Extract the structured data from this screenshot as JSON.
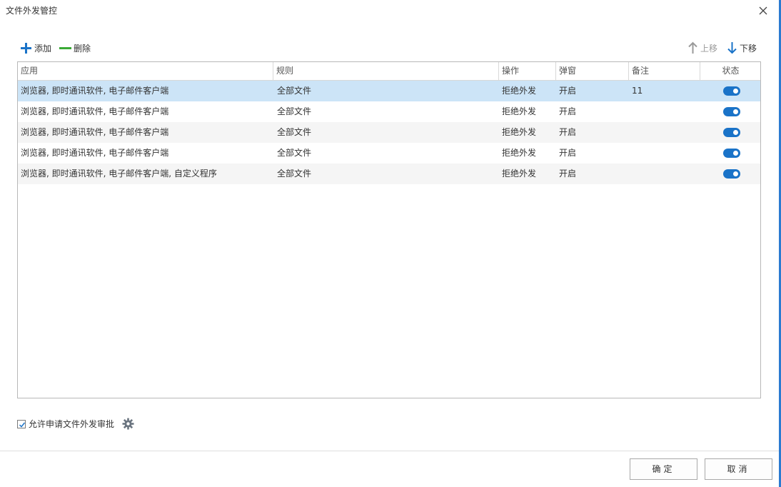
{
  "window": {
    "title": "文件外发管控"
  },
  "toolbar": {
    "add_label": "添加",
    "delete_label": "删除",
    "up_label": "上移",
    "down_label": "下移"
  },
  "table": {
    "columns": [
      "应用",
      "规则",
      "操作",
      "弹窗",
      "备注",
      "状态"
    ],
    "rows": [
      {
        "app": "浏览器, 即时通讯软件, 电子邮件客户端",
        "rule": "全部文件",
        "op": "拒绝外发",
        "popup": "开启",
        "note": "11",
        "status": true,
        "selected": true
      },
      {
        "app": "浏览器, 即时通讯软件, 电子邮件客户端",
        "rule": "全部文件",
        "op": "拒绝外发",
        "popup": "开启",
        "note": "",
        "status": true
      },
      {
        "app": "浏览器, 即时通讯软件, 电子邮件客户端",
        "rule": "全部文件",
        "op": "拒绝外发",
        "popup": "开启",
        "note": "",
        "status": true
      },
      {
        "app": "浏览器, 即时通讯软件, 电子邮件客户端",
        "rule": "全部文件",
        "op": "拒绝外发",
        "popup": "开启",
        "note": "",
        "status": true
      },
      {
        "app": "浏览器, 即时通讯软件, 电子邮件客户端, 自定义程序",
        "rule": "全部文件",
        "op": "拒绝外发",
        "popup": "开启",
        "note": "",
        "status": true
      }
    ]
  },
  "options": {
    "allow_request_label": "允许申请文件外发审批",
    "allow_request_checked": true
  },
  "footer": {
    "ok_label": "确定",
    "cancel_label": "取消"
  },
  "colors": {
    "accent": "#1a73c8",
    "add_icon": "#1a73c8",
    "delete_icon": "#3aaa35",
    "selected_row": "#cce4f7"
  }
}
